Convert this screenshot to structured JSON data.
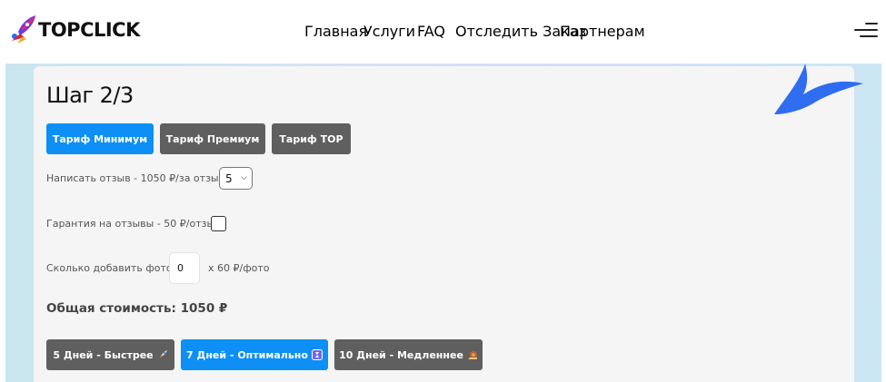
{
  "header": {
    "logo_text": "TOPCLICK",
    "nav": [
      "Главная",
      "Услуги",
      "FAQ",
      "Отследить Заказ",
      "Партнерам"
    ]
  },
  "step": {
    "title": "Шаг 2/3"
  },
  "tariffs": [
    {
      "label": "Тариф Минимум",
      "active": true
    },
    {
      "label": "Тариф Премиум",
      "active": false
    },
    {
      "label": "Тариф TOP",
      "active": false
    }
  ],
  "review": {
    "label": "Написать отзыв - 1050 ₽/за отзыв:",
    "selected": "5"
  },
  "guarantee": {
    "label": "Гарантия на отзывы - 50 ₽/отзыв:"
  },
  "photos": {
    "label": "Сколько добавить фото:",
    "value": "0",
    "suffix": "x 60 ₽/фото"
  },
  "total": {
    "text": "Общая стоимость: 1050 ₽"
  },
  "speeds": [
    {
      "label": "5 Дней - Быстрее",
      "icon": "rocket-icon",
      "active": false
    },
    {
      "label": "7 Дней - Оптимально",
      "icon": "hourglass-icon",
      "active": true
    },
    {
      "label": "10 Дней - Медленнее",
      "icon": "snail-icon",
      "active": false
    }
  ],
  "colors": {
    "primary_blue": "#0d8ff5",
    "button_gray": "#5f5f5f",
    "card_bg": "#f5f5f5",
    "plane_blue": "#2f6df0"
  }
}
